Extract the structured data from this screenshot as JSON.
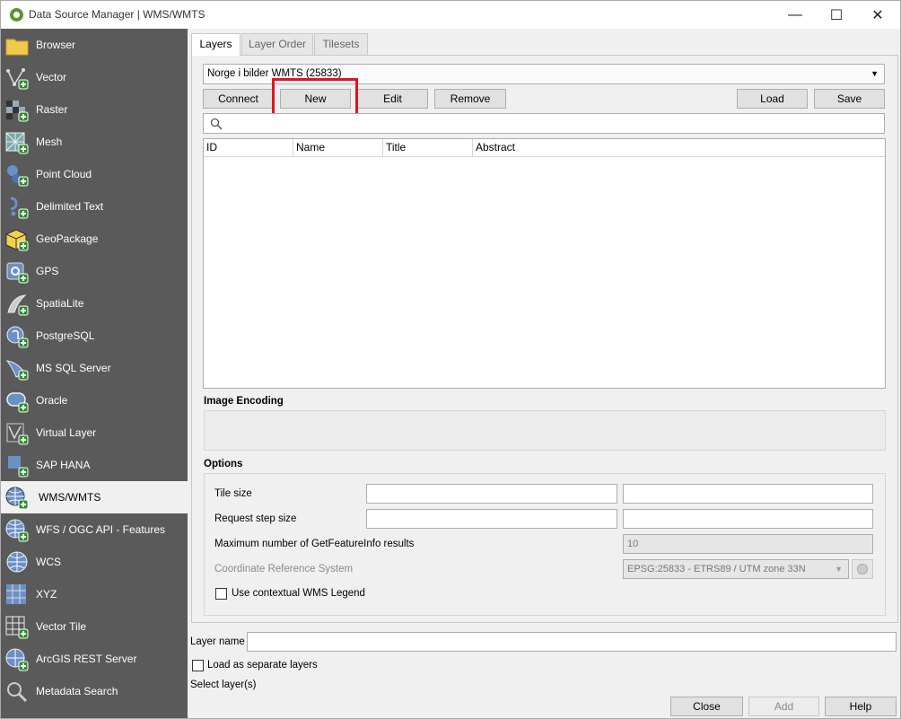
{
  "window": {
    "title": "Data Source Manager | WMS/WMTS"
  },
  "sidebar": {
    "items": [
      {
        "label": "Browser",
        "icon": "folder-icon"
      },
      {
        "label": "Vector",
        "icon": "vector-icon"
      },
      {
        "label": "Raster",
        "icon": "raster-icon"
      },
      {
        "label": "Mesh",
        "icon": "mesh-icon"
      },
      {
        "label": "Point Cloud",
        "icon": "point-cloud-icon"
      },
      {
        "label": "Delimited Text",
        "icon": "delimited-text-icon"
      },
      {
        "label": "GeoPackage",
        "icon": "geopackage-icon"
      },
      {
        "label": "GPS",
        "icon": "gps-icon"
      },
      {
        "label": "SpatiaLite",
        "icon": "spatialite-icon"
      },
      {
        "label": "PostgreSQL",
        "icon": "postgresql-icon"
      },
      {
        "label": "MS SQL Server",
        "icon": "mssql-icon"
      },
      {
        "label": "Oracle",
        "icon": "oracle-icon"
      },
      {
        "label": "Virtual Layer",
        "icon": "virtual-layer-icon"
      },
      {
        "label": "SAP HANA",
        "icon": "sap-hana-icon"
      },
      {
        "label": "WMS/WMTS",
        "icon": "wms-icon",
        "selected": true
      },
      {
        "label": "WFS / OGC API - Features",
        "icon": "wfs-icon"
      },
      {
        "label": "WCS",
        "icon": "wcs-icon"
      },
      {
        "label": "XYZ",
        "icon": "xyz-icon"
      },
      {
        "label": "Vector Tile",
        "icon": "vector-tile-icon"
      },
      {
        "label": "ArcGIS REST Server",
        "icon": "arcgis-icon"
      },
      {
        "label": "Metadata Search",
        "icon": "metadata-search-icon"
      }
    ]
  },
  "tabs": [
    "Layers",
    "Layer Order",
    "Tilesets"
  ],
  "connection": {
    "selected": "Norge i bilder WMTS (25833)"
  },
  "toolbar": {
    "connect": "Connect",
    "new": "New",
    "edit": "Edit",
    "remove": "Remove",
    "load": "Load",
    "save": "Save"
  },
  "search": {
    "placeholder": ""
  },
  "layer_table": {
    "columns": [
      "ID",
      "Name",
      "Title",
      "Abstract"
    ],
    "rows": []
  },
  "image_encoding": {
    "heading": "Image Encoding"
  },
  "options": {
    "heading": "Options",
    "tile_size_label": "Tile size",
    "request_step_label": "Request step size",
    "max_getfeatureinfo_label": "Maximum number of GetFeatureInfo results",
    "max_getfeatureinfo_value": "10",
    "crs_label": "Coordinate Reference System",
    "crs_value": "EPSG:25833 - ETRS89 / UTM zone 33N",
    "contextual_legend_label": "Use contextual WMS Legend"
  },
  "footer": {
    "layer_name_label": "Layer name",
    "load_separate_label": "Load as separate layers",
    "select_layers_label": "Select layer(s)",
    "close": "Close",
    "add": "Add",
    "help": "Help"
  },
  "highlight_color": "#e0141e"
}
